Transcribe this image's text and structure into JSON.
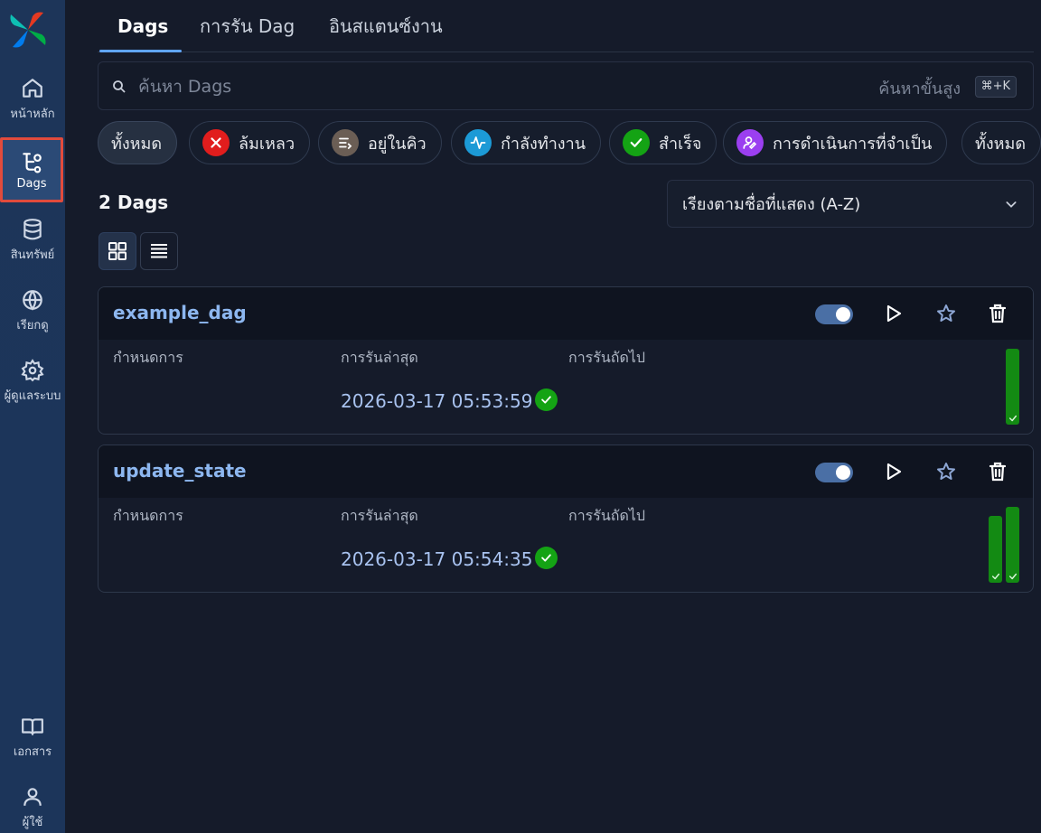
{
  "sidebar": {
    "items": [
      {
        "label": "หน้าหลัก",
        "icon": "home-icon"
      },
      {
        "label": "Dags",
        "icon": "dags-icon",
        "active": true
      },
      {
        "label": "สินทรัพย์",
        "icon": "database-icon"
      },
      {
        "label": "เรียกดู",
        "icon": "globe-icon"
      },
      {
        "label": "ผู้ดูแลระบบ",
        "icon": "gear-icon"
      }
    ],
    "bottom_items": [
      {
        "label": "เอกสาร",
        "icon": "book-icon"
      },
      {
        "label": "ผู้ใช้",
        "icon": "user-icon"
      }
    ]
  },
  "tabs": [
    {
      "label": "Dags",
      "active": true
    },
    {
      "label": "การรัน Dag"
    },
    {
      "label": "อินสแตนซ์งาน"
    }
  ],
  "search": {
    "placeholder": "ค้นหา Dags",
    "advanced_label": "ค้นหาขั้นสูง",
    "shortcut": "⌘+K"
  },
  "filters": [
    {
      "label": "ทั้งหมด",
      "selected": true
    },
    {
      "label": "ล้มเหลว",
      "color": "#e11d1d",
      "icon": "x-icon"
    },
    {
      "label": "อยู่ในคิว",
      "color": "#6b5e55",
      "icon": "queue-icon"
    },
    {
      "label": "กำลังทำงาน",
      "color": "#1c9ad6",
      "icon": "activity-icon"
    },
    {
      "label": "สำเร็จ",
      "color": "#14a314",
      "icon": "check-icon"
    },
    {
      "label": "การดำเนินการที่จำเป็น",
      "color": "#9b3ff0",
      "icon": "user-action-icon"
    },
    {
      "label": "ทั้งหมด"
    }
  ],
  "dag_count_label": "2 Dags",
  "sort": {
    "selected": "เรียงตามชื่อที่แสดง (A-Z)"
  },
  "columns": {
    "schedule": "กำหนดการ",
    "latest_run": "การรันล่าสุด",
    "next_run": "การรันถัดไป"
  },
  "dags": [
    {
      "name": "example_dag",
      "latest_run": "2026-03-17 05:53:59",
      "enabled": true,
      "run_bar_fractions": [
        1.0
      ]
    },
    {
      "name": "update_state",
      "latest_run": "2026-03-17 05:54:35",
      "enabled": true,
      "run_bar_fractions": [
        0.88,
        1.0
      ]
    }
  ],
  "colors": {
    "accent": "#60a5fa",
    "success": "#14a314",
    "active_nav_border": "#e14b3c"
  }
}
